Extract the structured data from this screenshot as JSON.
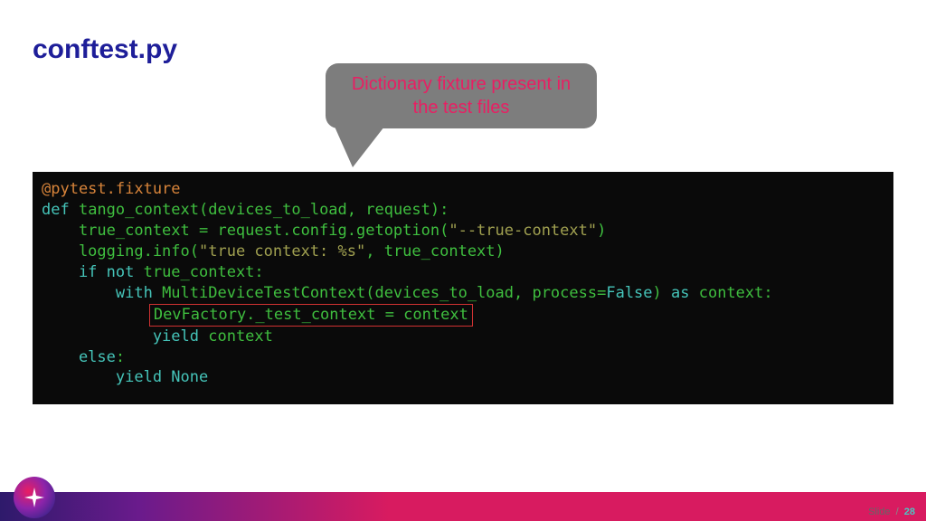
{
  "title": "conftest.py",
  "callout": {
    "line1": "Dictionary fixture present in",
    "line2": "the test files"
  },
  "code": {
    "l1a": "@pytest.fixture",
    "l2a": "def ",
    "l2b": "tango_context",
    "l2c": "(devices_to_load, request):",
    "l3a": "    true_context = request.config.getoption(",
    "l3b": "\"--true-context\"",
    "l3c": ")",
    "l4a": "    logging.info(",
    "l4b": "\"true context: %s\"",
    "l4c": ", true_context)",
    "l5a": "    if not ",
    "l5b": "true_context:",
    "l6a": "        with ",
    "l6b": "MultiDeviceTestContext(devices_to_load, process=",
    "l6c": "False",
    "l6d": ") ",
    "l6e": "as ",
    "l6f": "context:",
    "l7a": "            ",
    "l7b": "DevFactory._test_context = context",
    "l8a": "            yield ",
    "l8b": "context",
    "l9a": "    else",
    "l9b": ":",
    "l10a": "        yield ",
    "l10b": "None"
  },
  "footer": {
    "label": "Slide",
    "sep": "/",
    "number": "28"
  }
}
